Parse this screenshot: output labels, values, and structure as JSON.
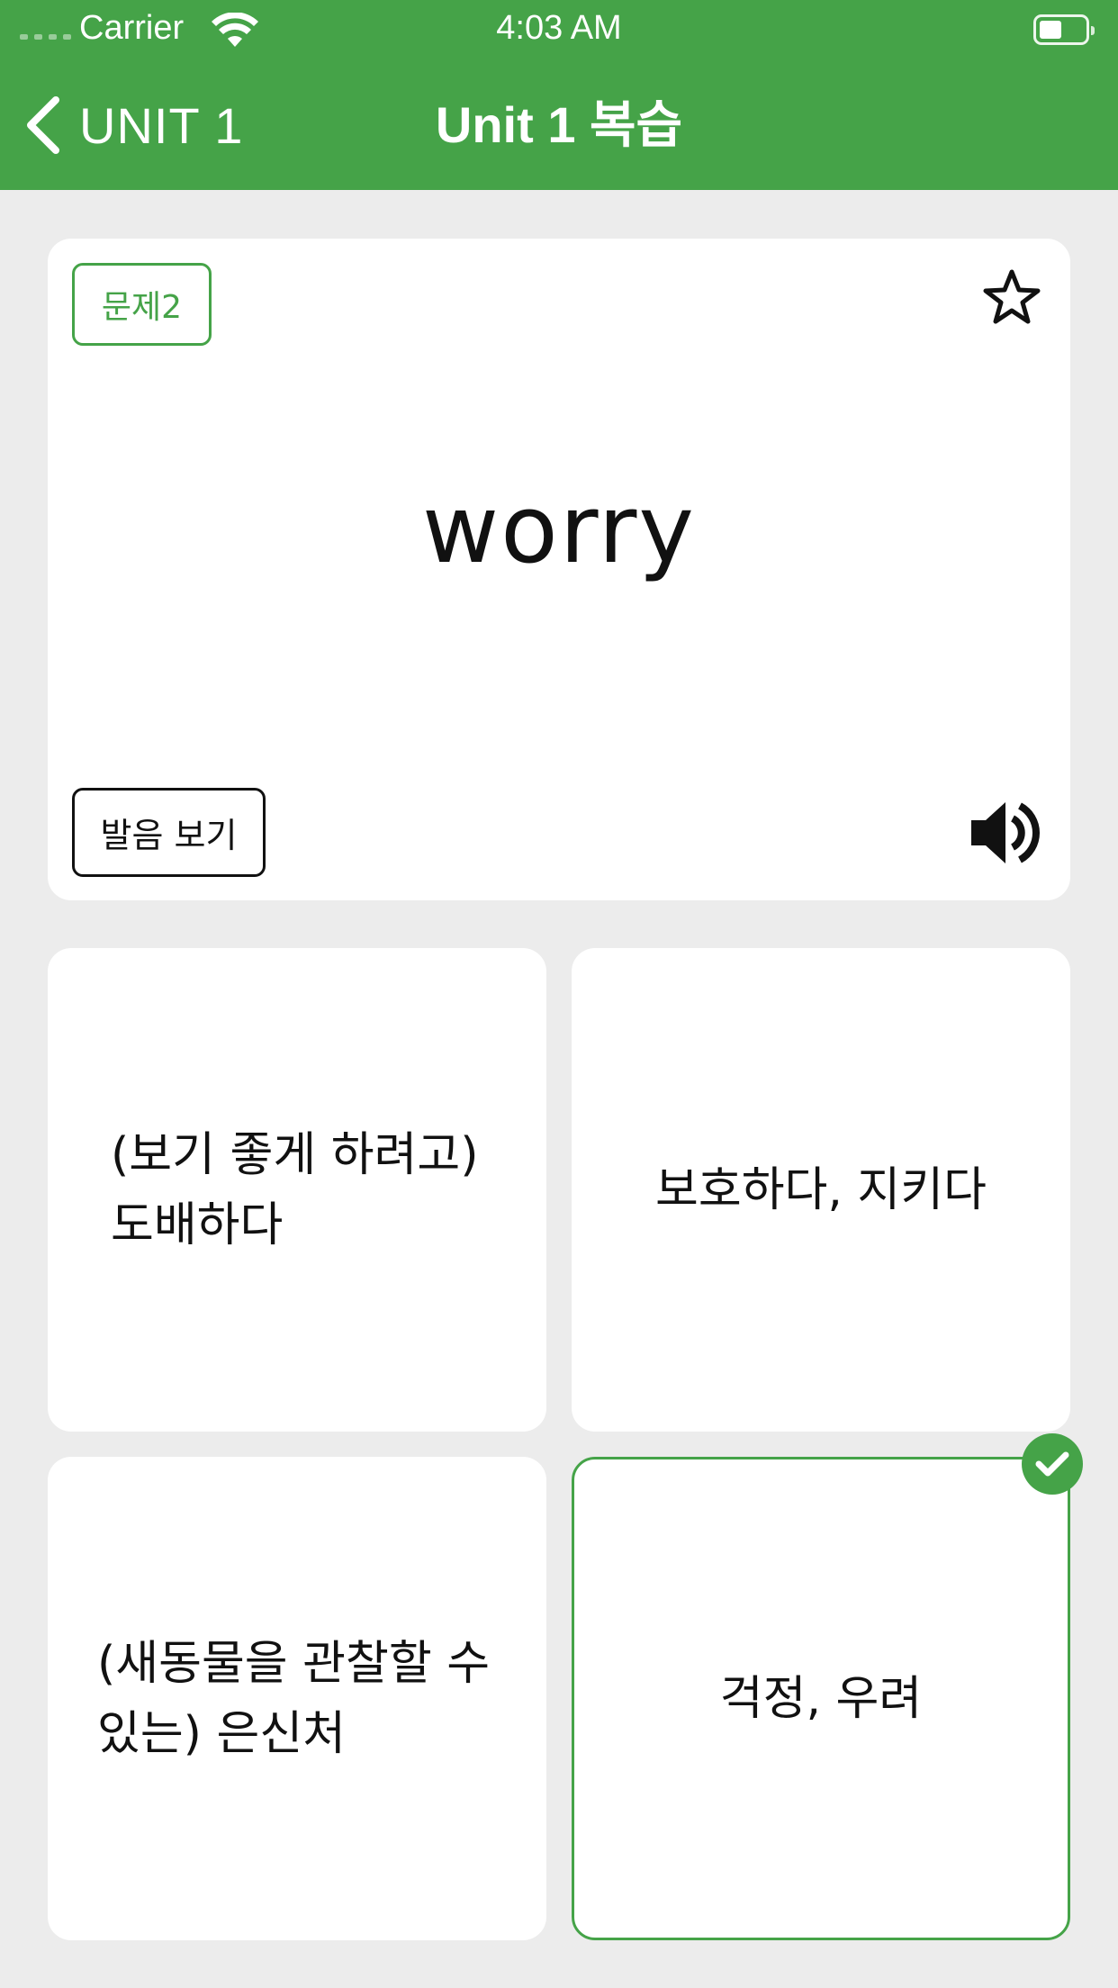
{
  "status_bar": {
    "carrier": "Carrier",
    "time": "4:03 AM",
    "wifi_icon": "wifi-icon",
    "battery_icon": "battery-icon"
  },
  "nav": {
    "back_label": "UNIT 1",
    "title": "Unit 1 복습",
    "background_color": "#45a348"
  },
  "question": {
    "badge": "문제2",
    "word": "worry",
    "pronunciation_button": "발음 보기",
    "favorite_icon": "star-outline-icon",
    "sound_icon": "speaker-icon"
  },
  "options": [
    {
      "text": "(보기 좋게 하려고)\n도배하다",
      "selected": false
    },
    {
      "text": "보호하다, 지키다",
      "selected": false
    },
    {
      "text": "(새동물을 관찰할 수\n있는) 은신처",
      "selected": false
    },
    {
      "text": "걱정, 우려",
      "selected": true
    }
  ],
  "colors": {
    "accent": "#45a348",
    "background": "#ececec",
    "card": "#ffffff"
  }
}
